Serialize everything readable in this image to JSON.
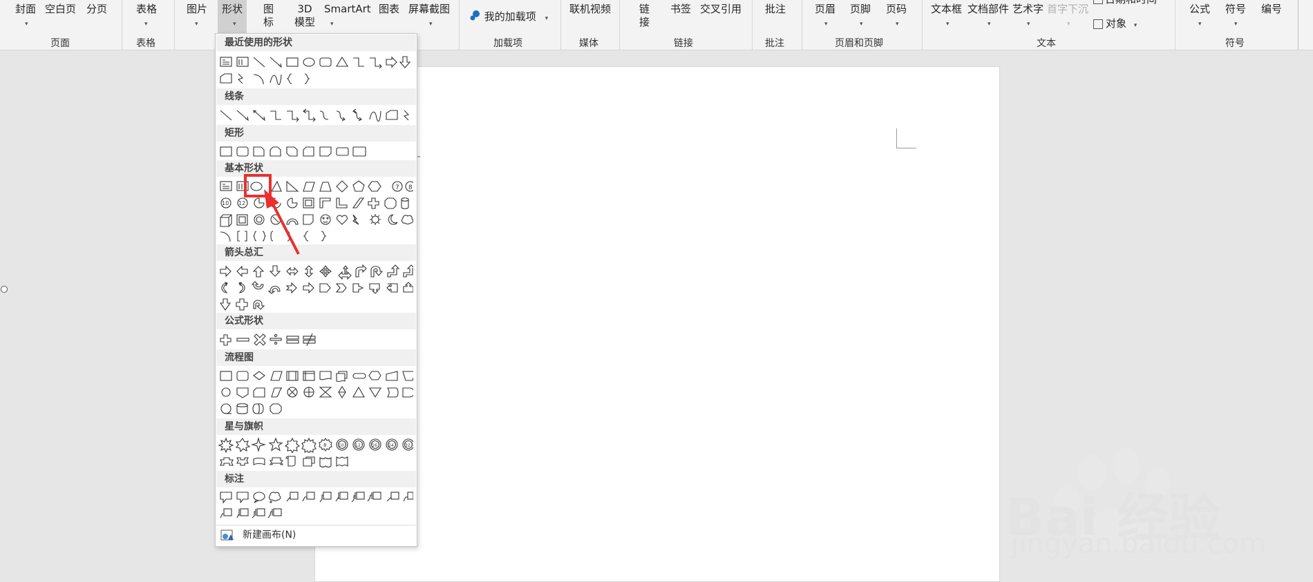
{
  "ribbon": {
    "buttons": {
      "cover": "封面",
      "blank_page": "空白页",
      "page_break": "分页",
      "table": "表格",
      "picture": "图片",
      "shapes": "形状",
      "icons_l1": "图",
      "icons_l2": "标",
      "model3d_l1": "3D",
      "model3d_l2": "模型",
      "smartart": "SmartArt",
      "chart": "图表",
      "screenshot": "屏幕截图",
      "my_addins": "我的加载项",
      "online_video": "联机视频",
      "link_l1": "链",
      "link_l2": "接",
      "bookmark": "书签",
      "cross_ref": "交叉引用",
      "comment": "批注",
      "header": "页眉",
      "footer": "页脚",
      "page_number": "页码",
      "text_box": "文本框",
      "quick_parts": "文档部件",
      "wordart": "艺术字",
      "drop_cap": "首字下沉",
      "date_time": "日期和时间",
      "object": "对象",
      "equation": "公式",
      "symbol": "符号",
      "numbering": "编号"
    },
    "groups": {
      "pages": "页面",
      "tables": "表格",
      "addins": "加载项",
      "media": "媒体",
      "links": "链接",
      "comments": "批注",
      "header_footer": "页眉和页脚",
      "text": "文本",
      "symbols": "符号"
    },
    "dropdown_glyph": "⌄"
  },
  "shapes_panel": {
    "sections": {
      "recent": "最近使用的形状",
      "lines": "线条",
      "rectangles": "矩形",
      "basic": "基本形状",
      "block_arrows": "箭头总汇",
      "equation_shapes": "公式形状",
      "flowchart": "流程图",
      "stars_banners": "星与旗帜",
      "callouts": "标注"
    },
    "new_canvas": "新建画布(N)",
    "selected_shape": "oval-shape"
  },
  "watermark": {
    "brand": "Bai 经验",
    "url": "jingyan.baidu.com"
  },
  "colors": {
    "highlight": "#e8302e",
    "ribbon_bg": "#f3f3f3",
    "canvas_bg": "#e6e6e6"
  }
}
